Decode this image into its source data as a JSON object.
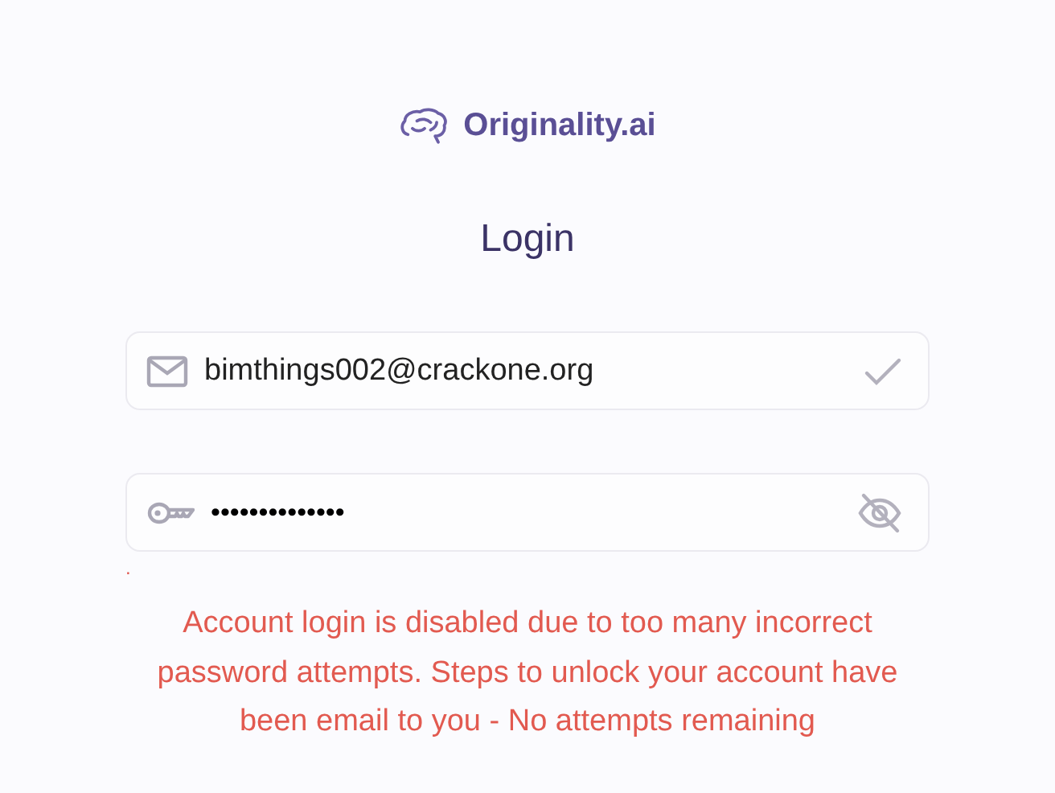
{
  "logo": {
    "text": "Originality.ai"
  },
  "heading": "Login",
  "email_field": {
    "value": "bimthings002@crackone.org",
    "valid": true
  },
  "password_field": {
    "value": "••••••••••••••",
    "visible": false
  },
  "stray_mark": ".",
  "error_message": "Account login is disabled due to too many incorrect password attempts. Steps to unlock your account have been email to you - No attempts remaining"
}
